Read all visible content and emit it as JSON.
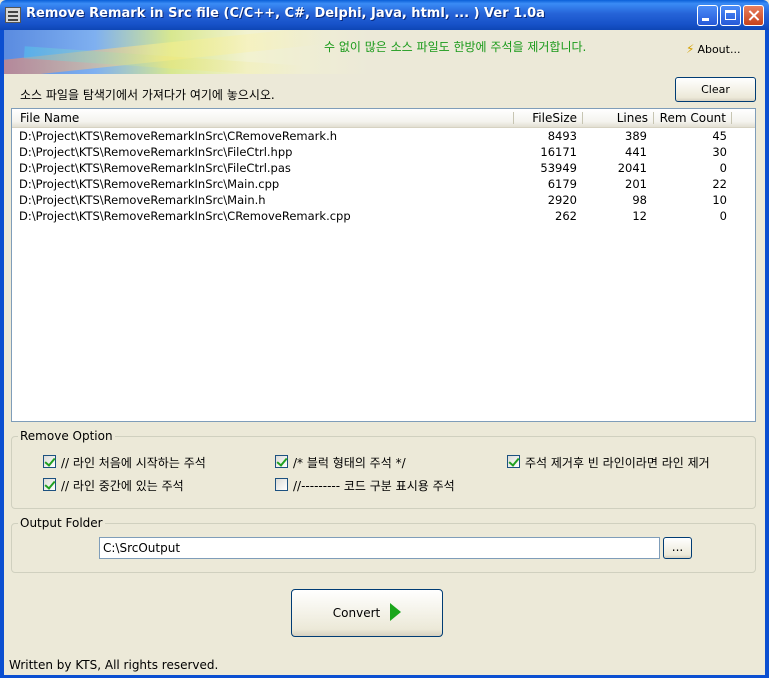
{
  "window": {
    "title": "Remove Remark in Src file (C/C++, C#, Delphi, Java, html, ... )  Ver 1.0a",
    "buttons": {
      "minimize_icon": "minimize-icon",
      "maximize_icon": "maximize-icon",
      "close_icon": "close-icon"
    }
  },
  "banner": {
    "message": "수 없이 많은 소스 파일도 한방에 주석을 제거합니다.",
    "about_label": "About..."
  },
  "drop_hint": "소스 파일을 탐색기에서 가져다가 여기에 놓으시오.",
  "clear_label": "Clear",
  "file_list": {
    "columns": [
      "File Name",
      "FileSize",
      "Lines",
      "Rem Count"
    ],
    "rows": [
      [
        "D:\\Project\\KTS\\RemoveRemarkInSrc\\CRemoveRemark.h",
        "8493",
        "389",
        "45"
      ],
      [
        "D:\\Project\\KTS\\RemoveRemarkInSrc\\FileCtrl.hpp",
        "16171",
        "441",
        "30"
      ],
      [
        "D:\\Project\\KTS\\RemoveRemarkInSrc\\FileCtrl.pas",
        "53949",
        "2041",
        "0"
      ],
      [
        "D:\\Project\\KTS\\RemoveRemarkInSrc\\Main.cpp",
        "6179",
        "201",
        "22"
      ],
      [
        "D:\\Project\\KTS\\RemoveRemarkInSrc\\Main.h",
        "2920",
        "98",
        "10"
      ],
      [
        "D:\\Project\\KTS\\RemoveRemarkInSrc\\CRemoveRemark.cpp",
        "262",
        "12",
        "0"
      ]
    ]
  },
  "remove_option": {
    "title": "Remove Option",
    "options": [
      {
        "label": "// 라인 처음에 시작하는 주석",
        "checked": true
      },
      {
        "label": "// 라인 중간에 있는 주석",
        "checked": true
      },
      {
        "label": "/* 블럭 형태의 주석  */",
        "checked": true
      },
      {
        "label": "//--------- 코드 구분 표시용 주석",
        "checked": false
      },
      {
        "label": "주석 제거후 빈 라인이라면 라인 제거",
        "checked": true
      }
    ]
  },
  "output_folder": {
    "title": "Output Folder",
    "value": "C:\\SrcOutput",
    "browse_label": "..."
  },
  "convert_label": "Convert",
  "footer": "Written by KTS, All rights reserved."
}
